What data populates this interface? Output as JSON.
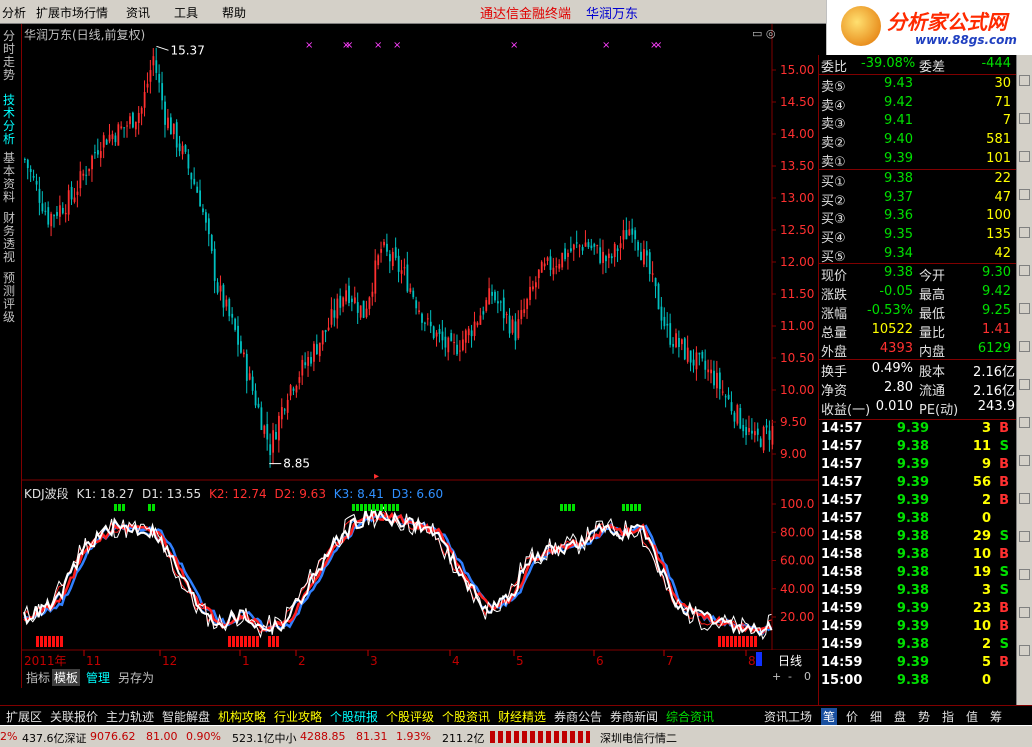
{
  "menu": {
    "items": [
      "分析",
      "扩展市场行情",
      "资讯",
      "工具",
      "帮助"
    ],
    "app_title": "通达信金融终端",
    "stock_title": "华润万东"
  },
  "logo": {
    "main": "分析家公式网",
    "sub": "www.88gs.com"
  },
  "left_tabs": [
    {
      "label": "分时走势",
      "active": false
    },
    {
      "label": "技术分析",
      "active": true
    },
    {
      "label": "基本资料",
      "active": false
    },
    {
      "label": "财务透视",
      "active": false
    },
    {
      "label": "预测评级",
      "active": false
    }
  ],
  "chart": {
    "title": "华润万东(日线,前复权)",
    "high_annotation": "15.37",
    "low_annotation": "8.85",
    "price_ticks": [
      "15.00",
      "14.50",
      "14.00",
      "13.50",
      "13.00",
      "12.50",
      "12.00",
      "11.50",
      "11.00",
      "10.50",
      "10.00",
      "9.50",
      "9.00"
    ],
    "kdj_ticks": [
      "100.0",
      "80.00",
      "60.00",
      "40.00",
      "20.00"
    ],
    "date_labels": [
      "2011年",
      "11",
      "12",
      "1",
      "2",
      "3",
      "4",
      "5",
      "6",
      "7",
      "8"
    ],
    "period_label": "日线"
  },
  "kdj_legend": {
    "name": "KDJ波段",
    "k1": "K1: 18.27",
    "d1": "D1: 13.55",
    "k2": "K2: 12.74",
    "d2": "D2: 9.63",
    "k3": "K3: 8.41",
    "d3": "D3: 6.60"
  },
  "chart_tabs": [
    "指标",
    "模板",
    "管理",
    "另存为"
  ],
  "period_buttons": [
    "+",
    "-",
    "0"
  ],
  "quote": {
    "weibi": {
      "label": "委比",
      "value": "-39.08%",
      "label2": "委差",
      "value2": "-444"
    },
    "sell": [
      {
        "label": "卖⑤",
        "price": "9.43",
        "vol": "30"
      },
      {
        "label": "卖④",
        "price": "9.42",
        "vol": "71"
      },
      {
        "label": "卖③",
        "price": "9.41",
        "vol": "7"
      },
      {
        "label": "卖②",
        "price": "9.40",
        "vol": "581"
      },
      {
        "label": "卖①",
        "price": "9.39",
        "vol": "101"
      }
    ],
    "buy": [
      {
        "label": "买①",
        "price": "9.38",
        "vol": "22"
      },
      {
        "label": "买②",
        "price": "9.37",
        "vol": "47"
      },
      {
        "label": "买③",
        "price": "9.36",
        "vol": "100"
      },
      {
        "label": "买④",
        "price": "9.35",
        "vol": "135"
      },
      {
        "label": "买⑤",
        "price": "9.34",
        "vol": "42"
      }
    ],
    "stats1": [
      {
        "l1": "现价",
        "v1": "9.38",
        "c1": "green",
        "l2": "今开",
        "v2": "9.30",
        "c2": "green"
      },
      {
        "l1": "涨跌",
        "v1": "-0.05",
        "c1": "green",
        "l2": "最高",
        "v2": "9.42",
        "c2": "green"
      },
      {
        "l1": "涨幅",
        "v1": "-0.53%",
        "c1": "green",
        "l2": "最低",
        "v2": "9.25",
        "c2": "green"
      },
      {
        "l1": "总量",
        "v1": "10522",
        "c1": "yellow",
        "l2": "量比",
        "v2": "1.41",
        "c2": "red"
      },
      {
        "l1": "外盘",
        "v1": "4393",
        "c1": "red",
        "l2": "内盘",
        "v2": "6129",
        "c2": "green"
      }
    ],
    "stats2": [
      {
        "l1": "换手",
        "v1": "0.49%",
        "l2": "股本",
        "v2": "2.16亿"
      },
      {
        "l1": "净资",
        "v1": "2.80",
        "l2": "流通",
        "v2": "2.16亿"
      },
      {
        "l1": "收益(一)",
        "v1": "0.010",
        "l2": "PE(动)",
        "v2": "243.9"
      }
    ],
    "ticks": [
      {
        "time": "14:57",
        "price": "9.39",
        "vol": "3",
        "bs": "B"
      },
      {
        "time": "14:57",
        "price": "9.38",
        "vol": "11",
        "bs": "S"
      },
      {
        "time": "14:57",
        "price": "9.39",
        "vol": "9",
        "bs": "B"
      },
      {
        "time": "14:57",
        "price": "9.39",
        "vol": "56",
        "bs": "B"
      },
      {
        "time": "14:57",
        "price": "9.39",
        "vol": "2",
        "bs": "B"
      },
      {
        "time": "14:57",
        "price": "9.38",
        "vol": "0",
        "bs": ""
      },
      {
        "time": "14:58",
        "price": "9.38",
        "vol": "29",
        "bs": "S"
      },
      {
        "time": "14:58",
        "price": "9.38",
        "vol": "10",
        "bs": "B"
      },
      {
        "time": "14:58",
        "price": "9.38",
        "vol": "19",
        "bs": "S"
      },
      {
        "time": "14:59",
        "price": "9.38",
        "vol": "3",
        "bs": "S"
      },
      {
        "time": "14:59",
        "price": "9.39",
        "vol": "23",
        "bs": "B"
      },
      {
        "time": "14:59",
        "price": "9.39",
        "vol": "10",
        "bs": "B"
      },
      {
        "time": "14:59",
        "price": "9.38",
        "vol": "2",
        "bs": "S"
      },
      {
        "time": "14:59",
        "price": "9.39",
        "vol": "5",
        "bs": "B"
      },
      {
        "time": "15:00",
        "price": "9.38",
        "vol": "0",
        "bs": ""
      }
    ]
  },
  "func_tabs": [
    {
      "label": "扩展区",
      "style": ""
    },
    {
      "label": "关联报价",
      "style": ""
    },
    {
      "label": "主力轨迹",
      "style": ""
    },
    {
      "label": "智能解盘",
      "style": ""
    },
    {
      "label": "机构攻略",
      "style": "yl"
    },
    {
      "label": "行业攻略",
      "style": "yl"
    },
    {
      "label": "个股研报",
      "style": "cy"
    },
    {
      "label": "个股评级",
      "style": "yl"
    },
    {
      "label": "个股资讯",
      "style": "yl"
    },
    {
      "label": "财经精选",
      "style": "yl"
    },
    {
      "label": "券商公告",
      "style": ""
    },
    {
      "label": "券商新闻",
      "style": ""
    },
    {
      "label": "综合资讯",
      "style": "gn"
    }
  ],
  "func_right": [
    "资讯工场",
    "笔",
    "价",
    "细",
    "盘",
    "势",
    "指",
    "值",
    "筹"
  ],
  "status": {
    "s1": "2%",
    "s2": "437.6亿深证",
    "s3": "9076.62",
    "s4": "81.00",
    "s5": "0.90%",
    "s6": "523.1亿中小",
    "s7": "4288.85",
    "s8": "81.31",
    "s9": "1.93%",
    "s10": "211.2亿",
    "s11": "深圳电信行情二"
  },
  "colors": {
    "up": "#ff3030",
    "down": "#00c0c0",
    "grid": "#800000",
    "k": "#ffffff",
    "d": "#ff2020",
    "j": "#3080ff"
  }
}
